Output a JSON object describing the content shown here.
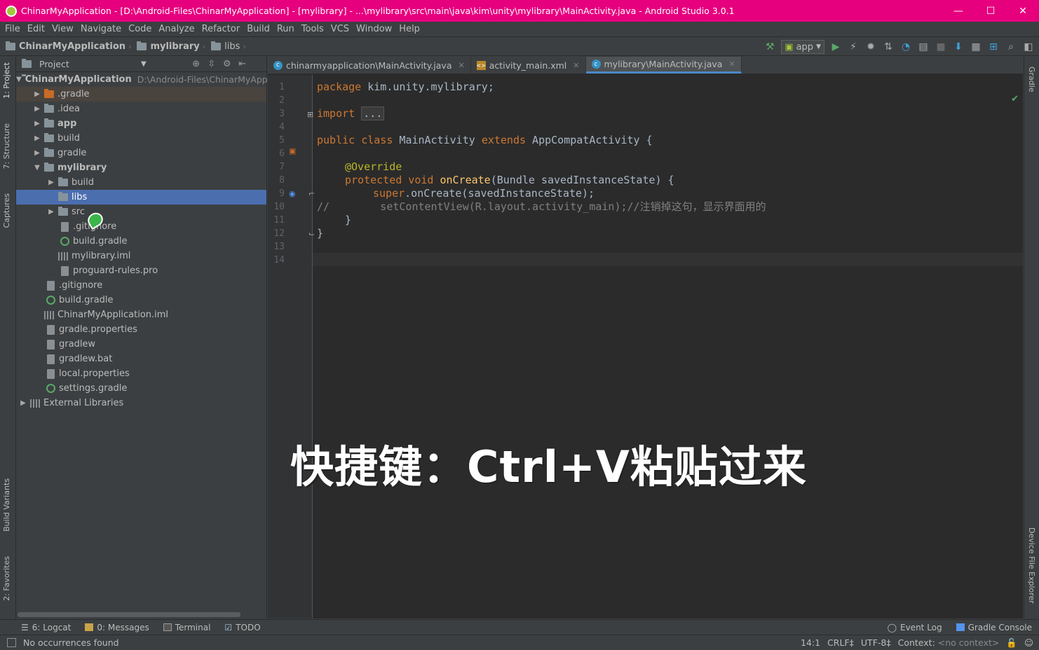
{
  "window": {
    "title": "ChinarMyApplication - [D:\\Android-Files\\ChinarMyApplication] - [mylibrary] - ...\\mylibrary\\src\\main\\java\\kim\\unity\\mylibrary\\MainActivity.java - Android Studio 3.0.1",
    "minimize": "—",
    "maximize": "☐",
    "close": "✕"
  },
  "menu": [
    "File",
    "Edit",
    "View",
    "Navigate",
    "Code",
    "Analyze",
    "Refactor",
    "Build",
    "Run",
    "Tools",
    "VCS",
    "Window",
    "Help"
  ],
  "breadcrumb": [
    "ChinarMyApplication",
    "mylibrary",
    "libs"
  ],
  "toolbar": {
    "run_config": "app",
    "icons": [
      "hammer-icon",
      "run-icon",
      "apply-changes-icon",
      "debug-icon",
      "attach-icon",
      "profile-icon",
      "coverage-icon",
      "stop-icon",
      "sdk-manager-icon",
      "avd-manager-icon",
      "project-structure-icon",
      "search-icon",
      "expand-icon"
    ]
  },
  "left_tabs": [
    "1: Project",
    "7: Structure",
    "Captures",
    "Build Variants",
    "2: Favorites"
  ],
  "right_tabs": [
    "Gradle",
    "Device File Explorer"
  ],
  "project_panel": {
    "title": "Project",
    "tree": [
      {
        "label": "ChinarMyApplication",
        "note": "D:\\Android-Files\\ChinarMyApp"
      },
      {
        "label": ".gradle"
      },
      {
        "label": ".idea"
      },
      {
        "label": "app"
      },
      {
        "label": "build"
      },
      {
        "label": "gradle"
      },
      {
        "label": "mylibrary"
      },
      {
        "label": "build"
      },
      {
        "label": "libs"
      },
      {
        "label": "src"
      },
      {
        "label": ".gitignore"
      },
      {
        "label": "build.gradle"
      },
      {
        "label": "mylibrary.iml"
      },
      {
        "label": "proguard-rules.pro"
      },
      {
        "label": ".gitignore"
      },
      {
        "label": "build.gradle"
      },
      {
        "label": "ChinarMyApplication.iml"
      },
      {
        "label": "gradle.properties"
      },
      {
        "label": "gradlew"
      },
      {
        "label": "gradlew.bat"
      },
      {
        "label": "local.properties"
      },
      {
        "label": "settings.gradle"
      },
      {
        "label": "External Libraries"
      }
    ]
  },
  "editor": {
    "tabs": [
      {
        "label": "chinarmyapplication\\MainActivity.java",
        "active": false
      },
      {
        "label": "activity_main.xml",
        "active": false
      },
      {
        "label": "mylibrary\\MainActivity.java",
        "active": true
      }
    ],
    "line_numbers": [
      "1",
      "2",
      "3",
      "4",
      "5",
      "6",
      "7",
      "8",
      "9",
      "10",
      "11",
      "12",
      "13",
      "14"
    ],
    "code": {
      "l1_kw": "package",
      "l1_rest": " kim.unity.mylibrary;",
      "l3_kw": "import",
      "l3_fold": "...",
      "l6_kw": "public class",
      "l6_name": " MainActivity ",
      "l6_kw2": "extends",
      "l6_rest": " AppCompatActivity {",
      "l8_ann": "@Override",
      "l9_kw": "protected void",
      "l9_fn": " onCreate",
      "l9_rest": "(Bundle savedInstanceState) {",
      "l10_kw": "super",
      "l10_rest": ".onCreate(savedInstanceState);",
      "l11_cm": "//        setContentView(R.layout.activity_main);//注销掉这句，显示界面用的",
      "l12": "}",
      "l13": "}"
    }
  },
  "caption": "快捷键：Ctrl+V粘贴过来",
  "bottom_tools": {
    "left": [
      "6: Logcat",
      "0: Messages",
      "Terminal",
      "TODO"
    ],
    "right": [
      "Event Log",
      "Gradle Console"
    ]
  },
  "status": {
    "message": "No occurrences found",
    "position": "14:1",
    "line_sep": "CRLF‡",
    "encoding": "UTF-8‡",
    "context_label": "Context:",
    "context_value": "<no context>"
  }
}
